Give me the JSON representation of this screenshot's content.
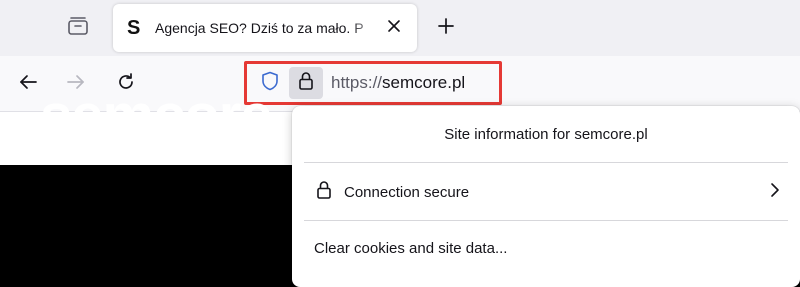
{
  "tabstrip": {
    "active_tab": {
      "favicon": "S",
      "title": "Agencja SEO? Dziś to za mało. P"
    }
  },
  "navbar": {
    "url_scheme": "https://",
    "url_host": "semcore.pl"
  },
  "page": {
    "brand_text": "semcore"
  },
  "popup": {
    "title": "Site information for semcore.pl",
    "connection_label": "Connection secure",
    "clear_label": "Clear cookies and site data..."
  },
  "icons": {
    "tab_overview": "tab-overview-icon",
    "close": "close-icon",
    "new_tab": "plus-icon",
    "back": "arrow-left-icon",
    "forward": "arrow-right-icon",
    "reload": "reload-icon",
    "tracking": "shield-icon",
    "lock": "lock-icon",
    "chevron": "chevron-right-icon"
  },
  "colors": {
    "highlight_border": "#e53935",
    "shield": "#3b6ad0",
    "tabstrip_bg": "#f0f0f4",
    "toolbar_bg": "#f9f9fb"
  }
}
